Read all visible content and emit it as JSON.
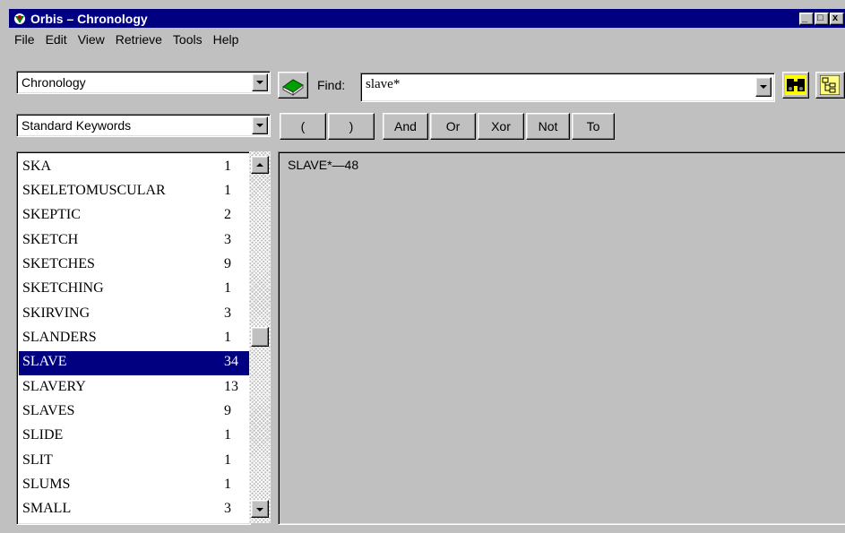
{
  "window": {
    "title": "Orbis – Chronology"
  },
  "menu": [
    "File",
    "Edit",
    "View",
    "Retrieve",
    "Tools",
    "Help"
  ],
  "toolbar": {
    "database_combo": "Chronology",
    "find_label": "Find:",
    "find_value": "slave*",
    "keywords_combo": "Standard Keywords",
    "operators": [
      "(",
      ")",
      "And",
      "Or",
      "Xor",
      "Not",
      "To"
    ]
  },
  "keywords": [
    {
      "word": "SKA",
      "count": "1"
    },
    {
      "word": "SKELETOMUSCULAR",
      "count": "1"
    },
    {
      "word": "SKEPTIC",
      "count": "2"
    },
    {
      "word": "SKETCH",
      "count": "3"
    },
    {
      "word": "SKETCHES",
      "count": "9"
    },
    {
      "word": "SKETCHING",
      "count": "1"
    },
    {
      "word": "SKIRVING",
      "count": "3"
    },
    {
      "word": "SLANDERS",
      "count": "1"
    },
    {
      "word": "SLAVE",
      "count": "34"
    },
    {
      "word": "SLAVERY",
      "count": "13"
    },
    {
      "word": "SLAVES",
      "count": "9"
    },
    {
      "word": "SLIDE",
      "count": "1"
    },
    {
      "word": "SLIT",
      "count": "1"
    },
    {
      "word": "SLUMS",
      "count": "1"
    },
    {
      "word": "SMALL",
      "count": "3"
    }
  ],
  "selected_keyword": "SLAVE",
  "results": {
    "line": "SLAVE*—48"
  },
  "icons": {
    "app": "orbis-app-icon",
    "book": "book-icon",
    "binoculars": "binoculars-search-icon",
    "tree": "tree-view-icon"
  },
  "colors": {
    "titlebar": "#000080",
    "selection": "#000080",
    "face": "#c0c0c0"
  }
}
